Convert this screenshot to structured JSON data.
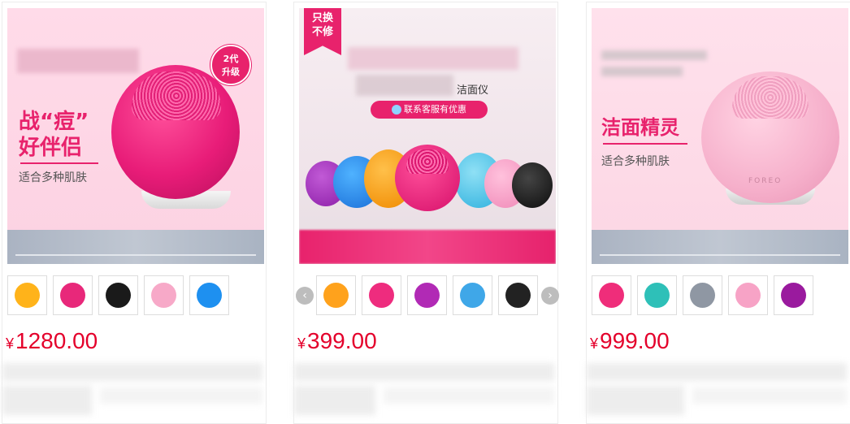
{
  "products": [
    {
      "badge": "2代\n升级",
      "slogan_line1": "战“痘”",
      "slogan_line2": "好伴侣",
      "subtitle": "适合多种肌肤",
      "price_symbol": "¥",
      "price": "1280.00",
      "thumb_colors": [
        "#ffb31a",
        "#e8287a",
        "#1a1a1a",
        "#f7a9c8",
        "#1e90f0"
      ]
    },
    {
      "corner_tag": "只换\n不修",
      "title_suffix": "洁面仪",
      "promo_button": "联系客服有优惠",
      "price_symbol": "¥",
      "price": "399.00",
      "thumb_colors": [
        "#ffa21c",
        "#ee2c7e",
        "#b12ab5",
        "#3fa7e8",
        "#222222"
      ]
    },
    {
      "slogan": "洁面精灵",
      "subtitle": "适合多种肌肤",
      "device_brand": "FOREO",
      "price_symbol": "¥",
      "price": "999.00",
      "thumb_colors": [
        "#ef2d7a",
        "#2ec0b8",
        "#8f97a3",
        "#f7a3c6",
        "#9a1a9e"
      ]
    }
  ]
}
